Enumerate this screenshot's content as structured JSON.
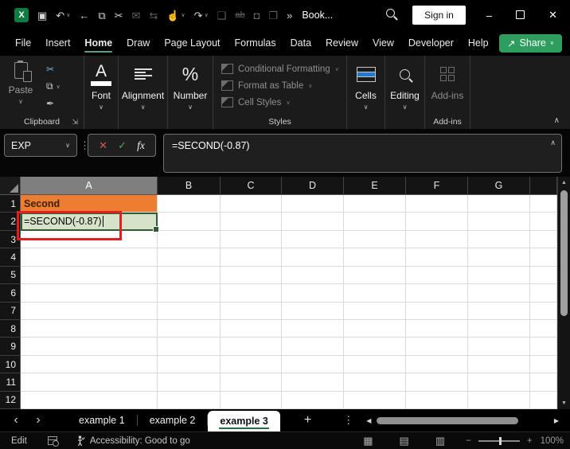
{
  "colors": {
    "accent_green": "#2E9E5F",
    "menu_underline": "#5F9C7F",
    "tab_underline": "#1E7145",
    "selection_border": "#2F5D31",
    "annotation_red": "#E02020",
    "excel_green": "#107C41"
  },
  "title_bar": {
    "icons": [
      {
        "name": "excel-logo-icon"
      },
      {
        "name": "save-icon"
      },
      {
        "name": "undo-icon",
        "chevron": true
      },
      {
        "name": "back-icon"
      },
      {
        "name": "copy-icon"
      },
      {
        "name": "cut-icon"
      },
      {
        "name": "mail-icon",
        "dim": true
      },
      {
        "name": "sync-icon",
        "dim": true
      },
      {
        "name": "touch-mode-icon",
        "chevron": true
      },
      {
        "name": "redo-icon",
        "chevron": true
      },
      {
        "name": "new-file-icon",
        "dim": true
      },
      {
        "name": "strikethrough-icon",
        "dim": true
      },
      {
        "name": "camera-icon",
        "dim": true
      },
      {
        "name": "document-search-icon",
        "dim": true
      },
      {
        "name": "more-commands-icon"
      }
    ],
    "document_title": "Book...",
    "sign_in_label": "Sign in"
  },
  "menu": {
    "tabs": [
      "File",
      "Insert",
      "Home",
      "Draw",
      "Page Layout",
      "Formulas",
      "Data",
      "Review",
      "View",
      "Developer",
      "Help"
    ],
    "active_tab": "Home",
    "share_label": "Share"
  },
  "ribbon": {
    "paste_label": "Paste",
    "groups": {
      "clipboard": "Clipboard",
      "styles": "Styles",
      "addins": "Add-ins"
    },
    "buttons": {
      "font": "Font",
      "alignment": "Alignment",
      "number": "Number",
      "cells": "Cells",
      "editing": "Editing",
      "addins": "Add-ins"
    },
    "styles_items": [
      "Conditional Formatting",
      "Format as Table",
      "Cell Styles"
    ]
  },
  "formula_bar": {
    "name_box_value": "EXP",
    "formula": "=SECOND(-0.87)"
  },
  "grid": {
    "column_headers": [
      "A",
      "B",
      "C",
      "D",
      "E",
      "F",
      "G"
    ],
    "row_headers": [
      "1",
      "2",
      "3",
      "4",
      "5",
      "6",
      "7",
      "8",
      "9",
      "10",
      "11",
      "12"
    ],
    "selected_column": "A",
    "cells": [
      {
        "ref": "A1",
        "text": "Second",
        "bg": "#ED7D31",
        "color": "#3B2300",
        "bold": true
      },
      {
        "ref": "A2",
        "text": "=SECOND(-0.87)",
        "bg": "#D6E3C8",
        "color": "#000000",
        "cursor": true
      }
    ]
  },
  "sheet_tabs": {
    "tabs": [
      "example 1",
      "example 2",
      "example 3"
    ],
    "active_tab": "example 3"
  },
  "status_bar": {
    "mode": "Edit",
    "accessibility_text": "Accessibility: Good to go",
    "zoom_level": "100%"
  }
}
